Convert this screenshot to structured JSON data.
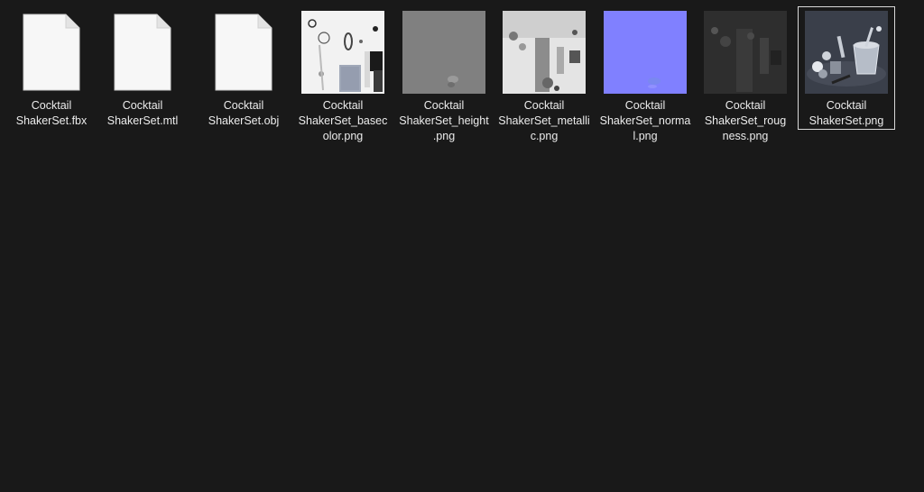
{
  "files": [
    {
      "line1": "Cocktail",
      "line2": "ShakerSet.fbx",
      "line3": "",
      "icon": "document-icon"
    },
    {
      "line1": "Cocktail",
      "line2": "ShakerSet.mtl",
      "line3": "",
      "icon": "document-icon"
    },
    {
      "line1": "Cocktail",
      "line2": "ShakerSet.obj",
      "line3": "",
      "icon": "document-icon"
    },
    {
      "line1": "Cocktail",
      "line2": "ShakerSet_basec",
      "line3": "olor.png",
      "icon": "basecolor-thumbnail"
    },
    {
      "line1": "Cocktail",
      "line2": "ShakerSet_height",
      "line3": ".png",
      "icon": "height-thumbnail"
    },
    {
      "line1": "Cocktail",
      "line2": "ShakerSet_metalli",
      "line3": "c.png",
      "icon": "metallic-thumbnail"
    },
    {
      "line1": "Cocktail",
      "line2": "ShakerSet_norma",
      "line3": "l.png",
      "icon": "normal-thumbnail"
    },
    {
      "line1": "Cocktail",
      "line2": "ShakerSet_roug",
      "line3": "ness.png",
      "icon": "roughness-thumbnail"
    },
    {
      "line1": "Cocktail",
      "line2": "ShakerSet.png",
      "line3": "",
      "icon": "render-thumbnail",
      "selected": true
    }
  ],
  "colors": {
    "background": "#191919",
    "selection_border": "#d9d9d9",
    "normal_map": "#8080ff",
    "height_map": "#808080"
  }
}
